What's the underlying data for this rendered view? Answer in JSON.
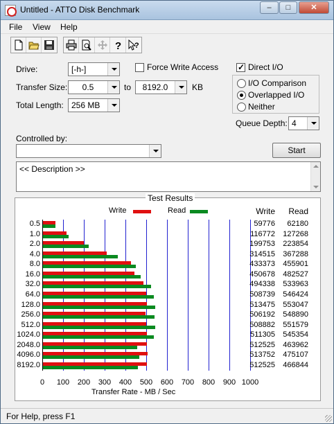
{
  "window": {
    "title": "Untitled - ATTO Disk Benchmark",
    "minimize_glyph": "–",
    "maximize_glyph": "□",
    "close_glyph": "✕"
  },
  "menu": {
    "file": "File",
    "view": "View",
    "help": "Help"
  },
  "toolbar_icons": [
    "new-document-icon",
    "open-folder-icon",
    "save-icon",
    "print-icon",
    "print-preview-icon",
    "move-icon",
    "help-icon",
    "context-help-icon"
  ],
  "settings": {
    "drive_label": "Drive:",
    "drive_value": "[-h-]",
    "transfer_size_label": "Transfer Size:",
    "transfer_from": "0.5",
    "to_label": "to",
    "transfer_to": "8192.0",
    "kb_label": "KB",
    "total_length_label": "Total Length:",
    "total_length_value": "256 MB",
    "force_write_label": "Force Write Access",
    "force_write_checked": false,
    "direct_io_label": "Direct I/O",
    "direct_io_checked": true,
    "io_comparison_label": "I/O Comparison",
    "overlapped_io_label": "Overlapped I/O",
    "neither_label": "Neither",
    "io_mode_selected": "Overlapped I/O",
    "queue_depth_label": "Queue Depth:",
    "queue_depth_value": "4",
    "controlled_by_label": "Controlled by:",
    "controlled_by_value": "",
    "start_label": "Start",
    "description": "<< Description >>"
  },
  "results": {
    "title": "Test Results",
    "legend_write": "Write",
    "legend_read": "Read",
    "col_write": "Write",
    "col_read": "Read"
  },
  "colors": {
    "write": "#e01010",
    "read": "#0a8a20",
    "grid": "#2020d0"
  },
  "chart_data": {
    "type": "bar",
    "orientation": "horizontal",
    "xlabel": "Transfer Rate - MB / Sec",
    "xlim": [
      0,
      1000
    ],
    "xticks": [
      0,
      100,
      200,
      300,
      400,
      500,
      600,
      700,
      800,
      900,
      1000
    ],
    "categories": [
      "0.5",
      "1.0",
      "2.0",
      "4.0",
      "8.0",
      "16.0",
      "32.0",
      "64.0",
      "128.0",
      "256.0",
      "512.0",
      "1024.0",
      "2048.0",
      "4096.0",
      "8192.0"
    ],
    "series": [
      {
        "name": "Write",
        "values": [
          59776,
          116772,
          199753,
          314515,
          433373,
          450678,
          494338,
          508739,
          513475,
          506192,
          508882,
          511305,
          512525,
          513752,
          512525
        ]
      },
      {
        "name": "Read",
        "values": [
          62180,
          127268,
          223854,
          367288,
          455901,
          482527,
          533963,
          546424,
          553047,
          548890,
          551579,
          545354,
          463962,
          475107,
          466844
        ]
      }
    ],
    "value_unit_scale": 1024
  },
  "status": {
    "text": "For Help, press F1"
  }
}
